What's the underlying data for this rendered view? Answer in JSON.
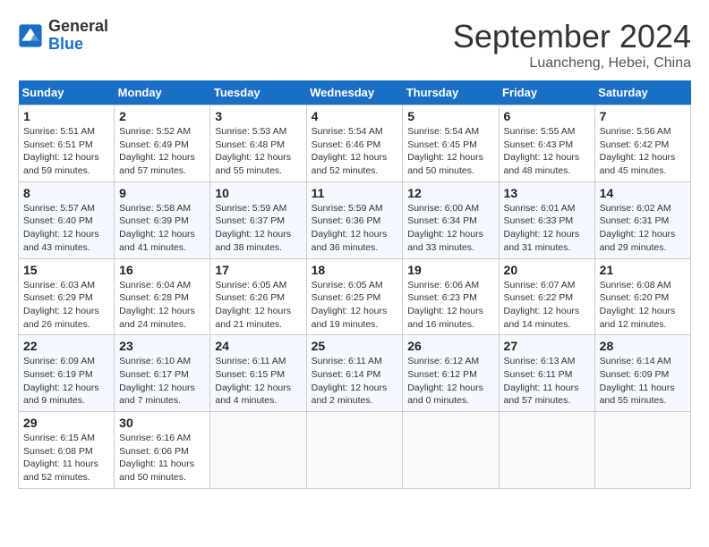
{
  "header": {
    "logo_general": "General",
    "logo_blue": "Blue",
    "month_year": "September 2024",
    "location": "Luancheng, Hebei, China"
  },
  "days_of_week": [
    "Sunday",
    "Monday",
    "Tuesday",
    "Wednesday",
    "Thursday",
    "Friday",
    "Saturday"
  ],
  "weeks": [
    [
      {
        "day": "1",
        "detail": "Sunrise: 5:51 AM\nSunset: 6:51 PM\nDaylight: 12 hours\nand 59 minutes."
      },
      {
        "day": "2",
        "detail": "Sunrise: 5:52 AM\nSunset: 6:49 PM\nDaylight: 12 hours\nand 57 minutes."
      },
      {
        "day": "3",
        "detail": "Sunrise: 5:53 AM\nSunset: 6:48 PM\nDaylight: 12 hours\nand 55 minutes."
      },
      {
        "day": "4",
        "detail": "Sunrise: 5:54 AM\nSunset: 6:46 PM\nDaylight: 12 hours\nand 52 minutes."
      },
      {
        "day": "5",
        "detail": "Sunrise: 5:54 AM\nSunset: 6:45 PM\nDaylight: 12 hours\nand 50 minutes."
      },
      {
        "day": "6",
        "detail": "Sunrise: 5:55 AM\nSunset: 6:43 PM\nDaylight: 12 hours\nand 48 minutes."
      },
      {
        "day": "7",
        "detail": "Sunrise: 5:56 AM\nSunset: 6:42 PM\nDaylight: 12 hours\nand 45 minutes."
      }
    ],
    [
      {
        "day": "8",
        "detail": "Sunrise: 5:57 AM\nSunset: 6:40 PM\nDaylight: 12 hours\nand 43 minutes."
      },
      {
        "day": "9",
        "detail": "Sunrise: 5:58 AM\nSunset: 6:39 PM\nDaylight: 12 hours\nand 41 minutes."
      },
      {
        "day": "10",
        "detail": "Sunrise: 5:59 AM\nSunset: 6:37 PM\nDaylight: 12 hours\nand 38 minutes."
      },
      {
        "day": "11",
        "detail": "Sunrise: 5:59 AM\nSunset: 6:36 PM\nDaylight: 12 hours\nand 36 minutes."
      },
      {
        "day": "12",
        "detail": "Sunrise: 6:00 AM\nSunset: 6:34 PM\nDaylight: 12 hours\nand 33 minutes."
      },
      {
        "day": "13",
        "detail": "Sunrise: 6:01 AM\nSunset: 6:33 PM\nDaylight: 12 hours\nand 31 minutes."
      },
      {
        "day": "14",
        "detail": "Sunrise: 6:02 AM\nSunset: 6:31 PM\nDaylight: 12 hours\nand 29 minutes."
      }
    ],
    [
      {
        "day": "15",
        "detail": "Sunrise: 6:03 AM\nSunset: 6:29 PM\nDaylight: 12 hours\nand 26 minutes."
      },
      {
        "day": "16",
        "detail": "Sunrise: 6:04 AM\nSunset: 6:28 PM\nDaylight: 12 hours\nand 24 minutes."
      },
      {
        "day": "17",
        "detail": "Sunrise: 6:05 AM\nSunset: 6:26 PM\nDaylight: 12 hours\nand 21 minutes."
      },
      {
        "day": "18",
        "detail": "Sunrise: 6:05 AM\nSunset: 6:25 PM\nDaylight: 12 hours\nand 19 minutes."
      },
      {
        "day": "19",
        "detail": "Sunrise: 6:06 AM\nSunset: 6:23 PM\nDaylight: 12 hours\nand 16 minutes."
      },
      {
        "day": "20",
        "detail": "Sunrise: 6:07 AM\nSunset: 6:22 PM\nDaylight: 12 hours\nand 14 minutes."
      },
      {
        "day": "21",
        "detail": "Sunrise: 6:08 AM\nSunset: 6:20 PM\nDaylight: 12 hours\nand 12 minutes."
      }
    ],
    [
      {
        "day": "22",
        "detail": "Sunrise: 6:09 AM\nSunset: 6:19 PM\nDaylight: 12 hours\nand 9 minutes."
      },
      {
        "day": "23",
        "detail": "Sunrise: 6:10 AM\nSunset: 6:17 PM\nDaylight: 12 hours\nand 7 minutes."
      },
      {
        "day": "24",
        "detail": "Sunrise: 6:11 AM\nSunset: 6:15 PM\nDaylight: 12 hours\nand 4 minutes."
      },
      {
        "day": "25",
        "detail": "Sunrise: 6:11 AM\nSunset: 6:14 PM\nDaylight: 12 hours\nand 2 minutes."
      },
      {
        "day": "26",
        "detail": "Sunrise: 6:12 AM\nSunset: 6:12 PM\nDaylight: 12 hours\nand 0 minutes."
      },
      {
        "day": "27",
        "detail": "Sunrise: 6:13 AM\nSunset: 6:11 PM\nDaylight: 11 hours\nand 57 minutes."
      },
      {
        "day": "28",
        "detail": "Sunrise: 6:14 AM\nSunset: 6:09 PM\nDaylight: 11 hours\nand 55 minutes."
      }
    ],
    [
      {
        "day": "29",
        "detail": "Sunrise: 6:15 AM\nSunset: 6:08 PM\nDaylight: 11 hours\nand 52 minutes."
      },
      {
        "day": "30",
        "detail": "Sunrise: 6:16 AM\nSunset: 6:06 PM\nDaylight: 11 hours\nand 50 minutes."
      },
      null,
      null,
      null,
      null,
      null
    ]
  ]
}
